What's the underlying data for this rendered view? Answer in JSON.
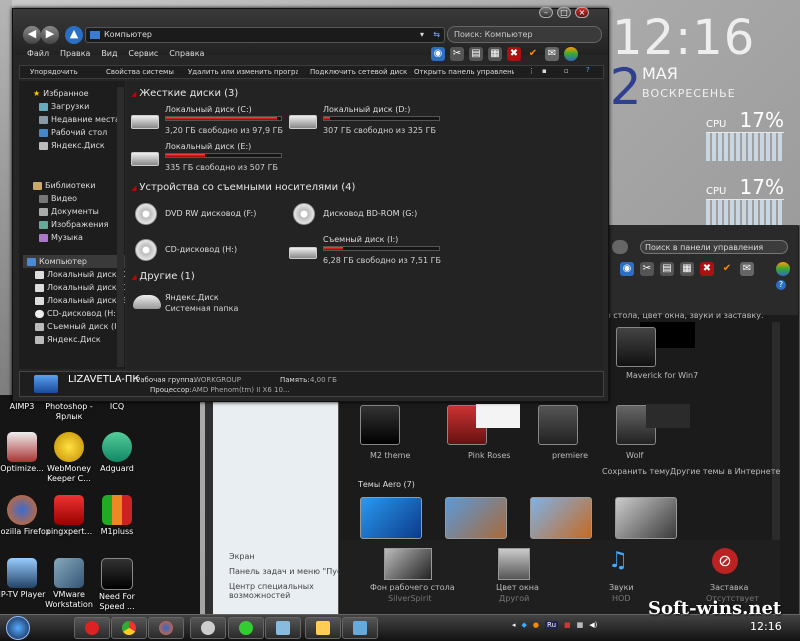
{
  "clock": {
    "time": "12:16",
    "day": "12",
    "month": "МАЯ",
    "weekday": "ВОСКРЕСЕНЬЕ"
  },
  "cpu_widgets": [
    {
      "label": "CPU",
      "percent": "17%"
    },
    {
      "label": "CPU",
      "percent": "17%"
    }
  ],
  "explorer": {
    "address": "Компьютер",
    "search_placeholder": "Поиск: Компьютер",
    "menu": [
      "Файл",
      "Правка",
      "Вид",
      "Сервис",
      "Справка"
    ],
    "toolbar": [
      "Упорядочить",
      "Свойства системы",
      "Удалить или изменить программу",
      "Подключить сетевой диск",
      "Открыть панель управления"
    ],
    "nav": {
      "favorites": [
        "Избранное",
        "Загрузки",
        "Недавние места",
        "Рабочий стол",
        "Яндекс.Диск"
      ],
      "libraries": [
        "Библиотеки",
        "Видео",
        "Документы",
        "Изображения",
        "Музыка"
      ],
      "computer": [
        "Компьютер",
        "Локальный диск (C:)",
        "Локальный диск (D:)",
        "Локальный диск (E:)",
        "CD-дисковод (H:)",
        "Съемный диск (I:)",
        "Яндекс.Диск"
      ]
    },
    "sections": {
      "hdd": "Жесткие диски (3)",
      "removable": "Устройства со съемными носителями (4)",
      "other": "Другие (1)"
    },
    "drives": [
      {
        "name": "Локальный диск (C:)",
        "free": "3,20 ГБ свободно из 97,9 ГБ",
        "used": 0.967
      },
      {
        "name": "Локальный диск (D:)",
        "free": "307 ГБ свободно из 325 ГБ",
        "used": 0.055
      },
      {
        "name": "Локальный диск (E:)",
        "free": "335 ГБ свободно из 507 ГБ",
        "used": 0.339
      }
    ],
    "removable": [
      {
        "name": "DVD RW дисковод (F:)"
      },
      {
        "name": "Дисковод BD-ROM (G:)"
      },
      {
        "name": "CD-дисковод (H:)"
      },
      {
        "name": "Съемный диск (I:)",
        "free": "6,28 ГБ свободно из 7,51 ГБ",
        "used": 0.164
      }
    ],
    "other": {
      "name": "Яндекс.Диск",
      "sub": "Системная папка"
    },
    "status": {
      "pc": "LIZAVETLA-ПК",
      "wg_label": "Рабочая группа:",
      "wg": "WORKGROUP",
      "mem_label": "Память:",
      "mem": "4,00 ГБ",
      "cpu_label": "Процессор:",
      "cpu": "AMD Phenom(tm) II X6 10..."
    }
  },
  "control_panel": {
    "search_placeholder": "Поиск в панели управления",
    "desc": "ю стола, цвет окна, звуки и заставку.",
    "themes_top": [
      "Maverick for Win7"
    ],
    "themes_mid": [
      "M2 theme",
      "Pink Roses",
      "premiere",
      "Wolf"
    ],
    "save_theme": "Сохранить тему",
    "more_themes": "Другие темы в Интернете",
    "aero_header": "Темы Aero (7)",
    "bottom": [
      {
        "label": "Фон рабочего стола",
        "sub": "SilverSpirit"
      },
      {
        "label": "Цвет окна",
        "sub": "Другой"
      },
      {
        "label": "Звуки",
        "sub": "HOD"
      },
      {
        "label": "Заставка",
        "sub": "Отсутствует"
      }
    ],
    "side": [
      "Экран",
      "Панель задач и меню \"Пуск\"",
      "Центр специальных возможностей"
    ]
  },
  "desktop_icons": [
    {
      "label": "AIMP3"
    },
    {
      "label": "Photoshop - Ярлык"
    },
    {
      "label": "ICQ"
    },
    {
      "label": "Optimize..."
    },
    {
      "label": "WebMoney Keeper C..."
    },
    {
      "label": "Adguard"
    },
    {
      "label": "Mozilla Firefox"
    },
    {
      "label": "pingxpert..."
    },
    {
      "label": "M1pluss"
    },
    {
      "label": "IP-TV Player"
    },
    {
      "label": "VMware Workstation"
    },
    {
      "label": "Need For Speed ..."
    }
  ],
  "taskbar": {
    "clock": "12:16",
    "lang": "Ru"
  },
  "watermark": "Soft-wins.net"
}
